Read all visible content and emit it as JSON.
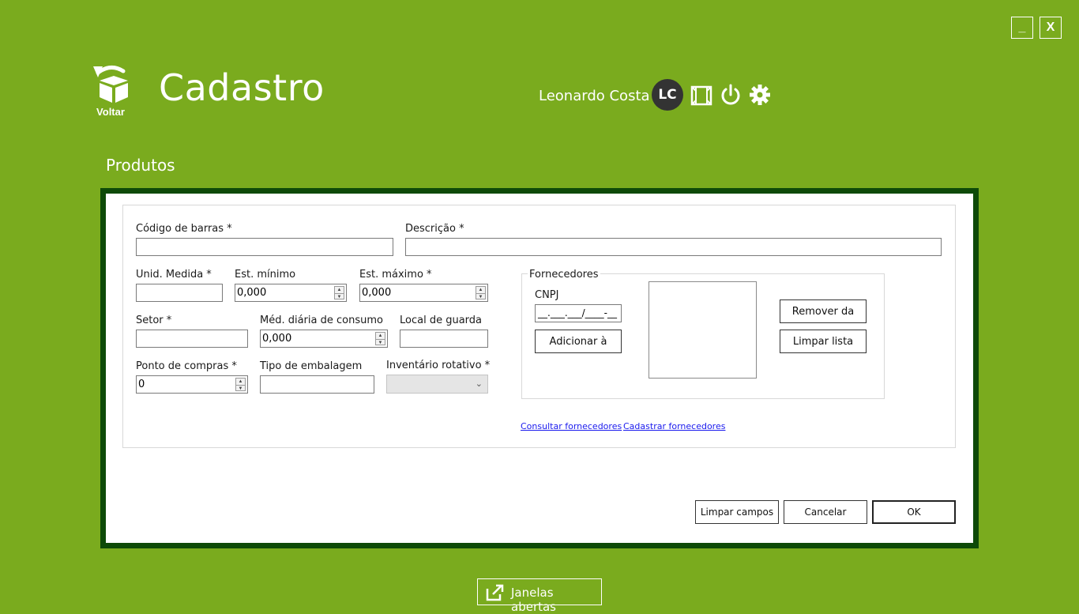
{
  "window": {
    "minimize_label": "_",
    "close_label": "X"
  },
  "header": {
    "back_label": "Voltar",
    "title": "Cadastro",
    "user_name": "Leonardo Costa",
    "avatar_initials": "LC",
    "icons": [
      "fullscreen-icon",
      "power-icon",
      "gear-icon"
    ]
  },
  "section_title": "Produtos",
  "form": {
    "codigo_barras": {
      "label": "Código de barras *",
      "value": ""
    },
    "descricao": {
      "label": "Descrição *",
      "value": ""
    },
    "unid_medida": {
      "label": "Unid. Medida *",
      "value": ""
    },
    "est_minimo": {
      "label": "Est. mínimo",
      "value": "0,000"
    },
    "est_maximo": {
      "label": "Est. máximo *",
      "value": "0,000"
    },
    "setor": {
      "label": "Setor *",
      "value": ""
    },
    "med_diaria": {
      "label": "Méd. diária de consumo",
      "value": "0,000"
    },
    "local_guarda": {
      "label": "Local de guarda",
      "value": ""
    },
    "ponto_compras": {
      "label": "Ponto de compras *",
      "value": "0"
    },
    "tipo_embalagem": {
      "label": "Tipo de embalagem",
      "value": ""
    },
    "inventario_rotativo": {
      "label": "Inventário rotativo *",
      "value": ""
    }
  },
  "fornecedores": {
    "group_title": "Fornecedores",
    "cnpj_label": "CNPJ",
    "cnpj_mask": "__.___.___/____-__",
    "add_button": "Adicionar à",
    "remove_button": "Remover da",
    "clear_button": "Limpar lista",
    "consult_link": "Consultar fornecedores",
    "register_link": "Cadastrar fornecedores"
  },
  "actions": {
    "clear_fields": "Limpar campos",
    "cancel": "Cancelar",
    "ok": "OK"
  },
  "footer": {
    "open_windows": "Janelas abertas"
  },
  "colors": {
    "background": "#7aab1e",
    "panel_border": "#0e4a08",
    "avatar": "#333333"
  }
}
